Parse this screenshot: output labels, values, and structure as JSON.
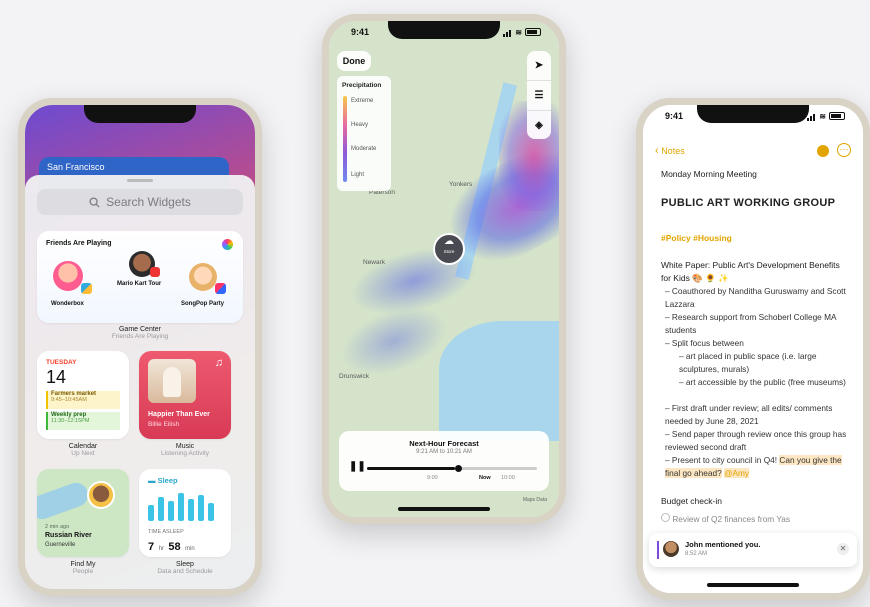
{
  "left_phone": {
    "city_card": "San Francisco",
    "search_placeholder": "Search Widgets",
    "friends_widget": {
      "title": "Friends Are Playing",
      "players": [
        "Wonderbox",
        "Mario Kart Tour",
        "SongPop Party"
      ],
      "caption": "Game Center",
      "caption_sub": "Friends Are Playing"
    },
    "calendar_widget": {
      "day": "TUESDAY",
      "date": "14",
      "event1_title": "Farmers market",
      "event1_time": "9:45–10:45AM",
      "event2_title": "Weekly prep",
      "event2_time": "11:30–12:15PM",
      "caption": "Calendar",
      "caption_sub": "Up Next"
    },
    "music_widget": {
      "song": "Happier Than Ever",
      "artist": "Billie Eilish",
      "caption": "Music",
      "caption_sub": "Listening Activity"
    },
    "findmy_widget": {
      "time_ago": "2 min ago",
      "place": "Russian River",
      "sub_place": "Guerneville",
      "caption": "Find My",
      "caption_sub": "People"
    },
    "sleep_widget": {
      "title": "Sleep",
      "label": "TIME ASLEEP",
      "hours": "7",
      "hours_unit": "hr",
      "minutes": "58",
      "minutes_unit": "min",
      "caption": "Sleep",
      "caption_sub": "Data and Schedule"
    }
  },
  "middle_phone": {
    "time": "9:41",
    "done_label": "Done",
    "legend": {
      "title": "Precipitation",
      "levels": [
        "Extreme",
        "Heavy",
        "Moderate",
        "Light"
      ]
    },
    "places": [
      "Paterson",
      "Yonkers",
      "Newark",
      "Drunswick"
    ],
    "weather_pin": "Store",
    "forecast": {
      "title": "Next-Hour Forecast",
      "subtitle": "9:21 AM to 10:21 AM",
      "ticks": [
        "9:00",
        "Now",
        "10:00"
      ]
    },
    "attribution": "Maps Data"
  },
  "right_phone": {
    "time": "9:41",
    "back_label": "Notes",
    "meeting": "Monday Morning Meeting",
    "heading": "PUBLIC ART WORKING GROUP",
    "tags": "#Policy #Housing",
    "paper_title": "White Paper: Public Art's Development Benefits for Kids 🎨 🌻 ✨",
    "bullets": [
      "Coauthored by Nanditha Guruswamy and Scott Lazzara",
      "Research support from Schoberl College MA students",
      "Split focus between",
      "art placed in public space (i.e. large sculptures, murals)",
      "art accessible by the public (free museums)",
      "First draft under review; all edits/ comments needed by June 28, 2021",
      "Send paper through review once this group has reviewed second draft",
      "Present to city council in Q4!"
    ],
    "highlight": "Can you give the final go ahead?",
    "mention": "@Amy",
    "budget": "Budget check-in",
    "budget_item": "Review of Q2 finances from Yas",
    "toast_text": "John mentioned you.",
    "toast_name": "John",
    "toast_time": "8:52 AM"
  }
}
